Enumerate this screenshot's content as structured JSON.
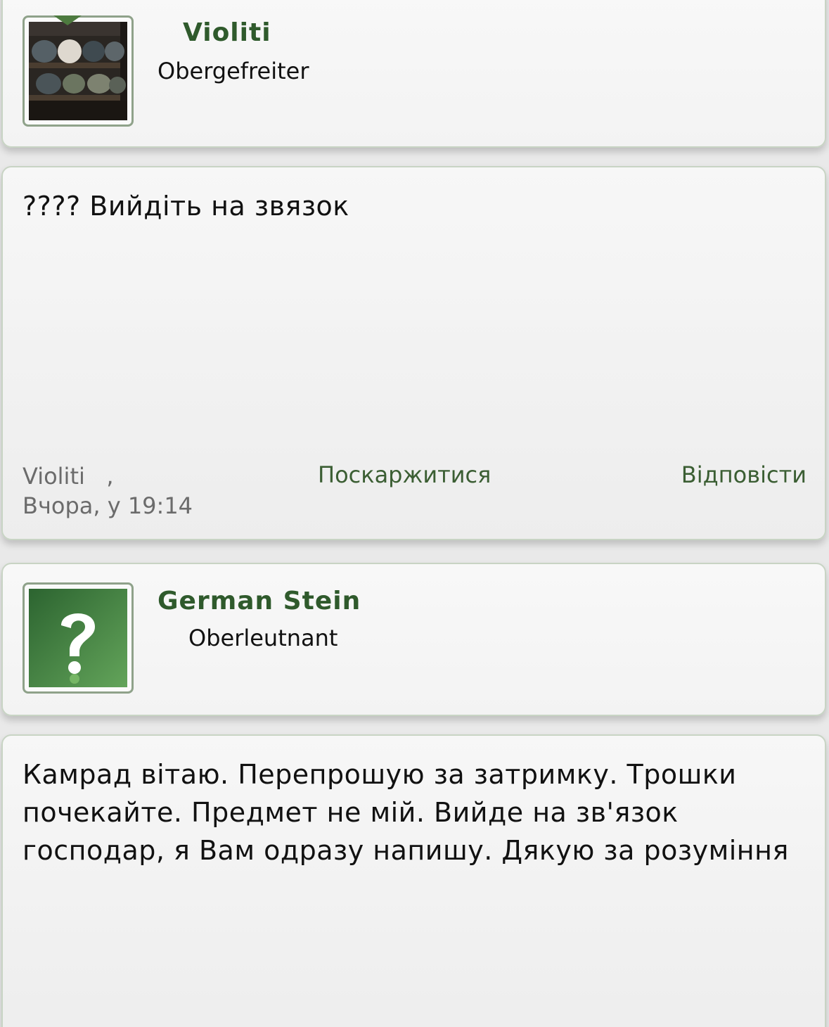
{
  "posts": [
    {
      "author": {
        "name": "Violiti",
        "rank": "Obergefreiter"
      },
      "message": "???? Вийдіть на звязок",
      "meta": {
        "author_line": "Violiti   ,",
        "time": "Вчора, у 19:14"
      },
      "actions": {
        "report": "Поскаржитися",
        "reply": "Відповісти"
      }
    },
    {
      "author": {
        "name": "German Stein",
        "rank": "Oberleutnant"
      },
      "message": "Камрад вітаю. Перепрошую за затримку. Трошки почекайте. Предмет не мій. Вийде на зв'язок господар, я Вам одразу напишу. Дякую за розуміння"
    }
  ],
  "colors": {
    "accent": "#2f5a2c",
    "link": "#3b5e33",
    "card_border": "#c8d4c4",
    "avatar_green": "#3d7a3a"
  },
  "icons": {
    "avatar_placeholder": "question-mark-icon"
  }
}
